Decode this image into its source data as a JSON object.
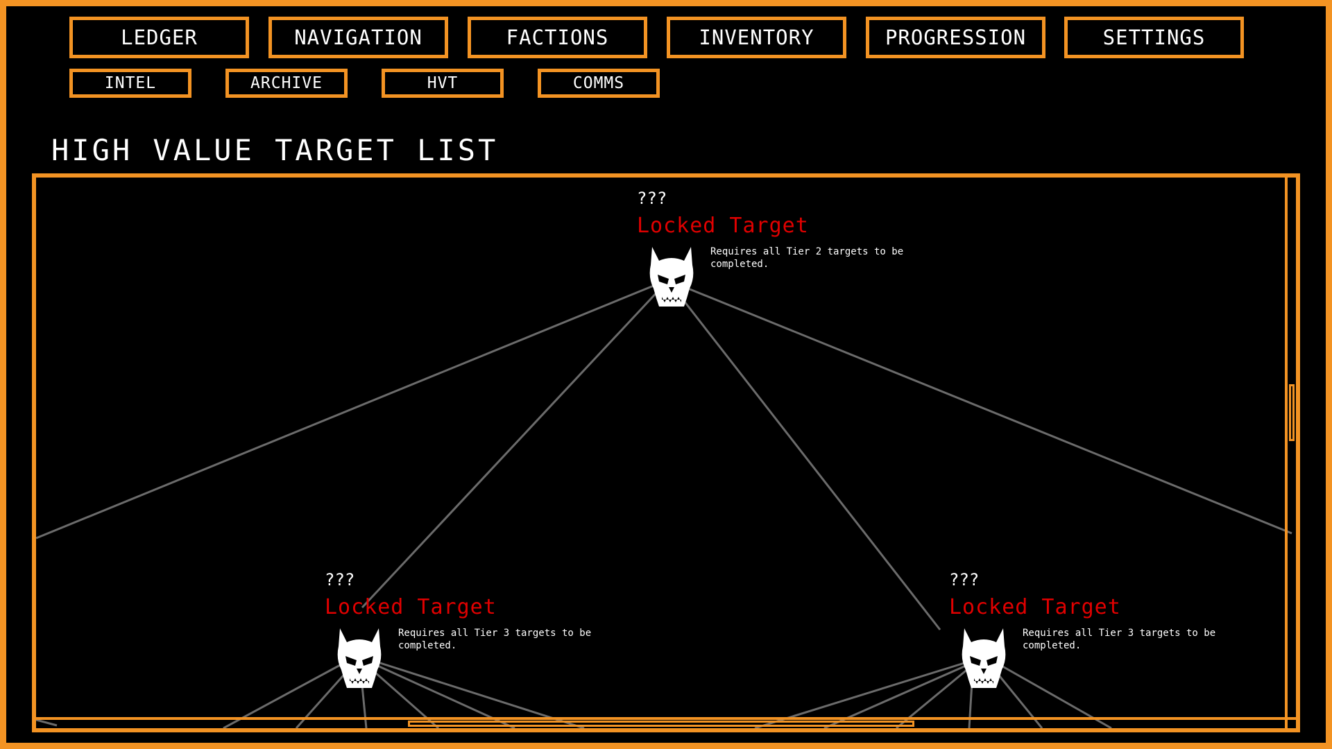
{
  "main_tabs": [
    {
      "label": "LEDGER"
    },
    {
      "label": "NAVIGATION"
    },
    {
      "label": "FACTIONS"
    },
    {
      "label": "INVENTORY"
    },
    {
      "label": "PROGRESSION"
    },
    {
      "label": "SETTINGS"
    }
  ],
  "sub_tabs": [
    {
      "label": "INTEL"
    },
    {
      "label": "ARCHIVE"
    },
    {
      "label": "HVT"
    },
    {
      "label": "COMMS"
    }
  ],
  "page_title": "HIGH VALUE TARGET LIST",
  "targets": [
    {
      "name": "???",
      "status": "Locked Target",
      "requirement": "Requires all Tier 2 targets to be completed.",
      "icon": "demon-skull-icon"
    },
    {
      "name": "???",
      "status": "Locked Target",
      "requirement": "Requires all Tier 3 targets to be completed.",
      "icon": "demon-skull-icon"
    },
    {
      "name": "???",
      "status": "Locked Target",
      "requirement": "Requires all Tier 3 targets to be completed.",
      "icon": "demon-skull-icon"
    }
  ],
  "colors": {
    "accent": "#f39323",
    "locked": "#e00000",
    "line": "#6b6b6b",
    "background": "#000000",
    "text": "#ffffff"
  }
}
